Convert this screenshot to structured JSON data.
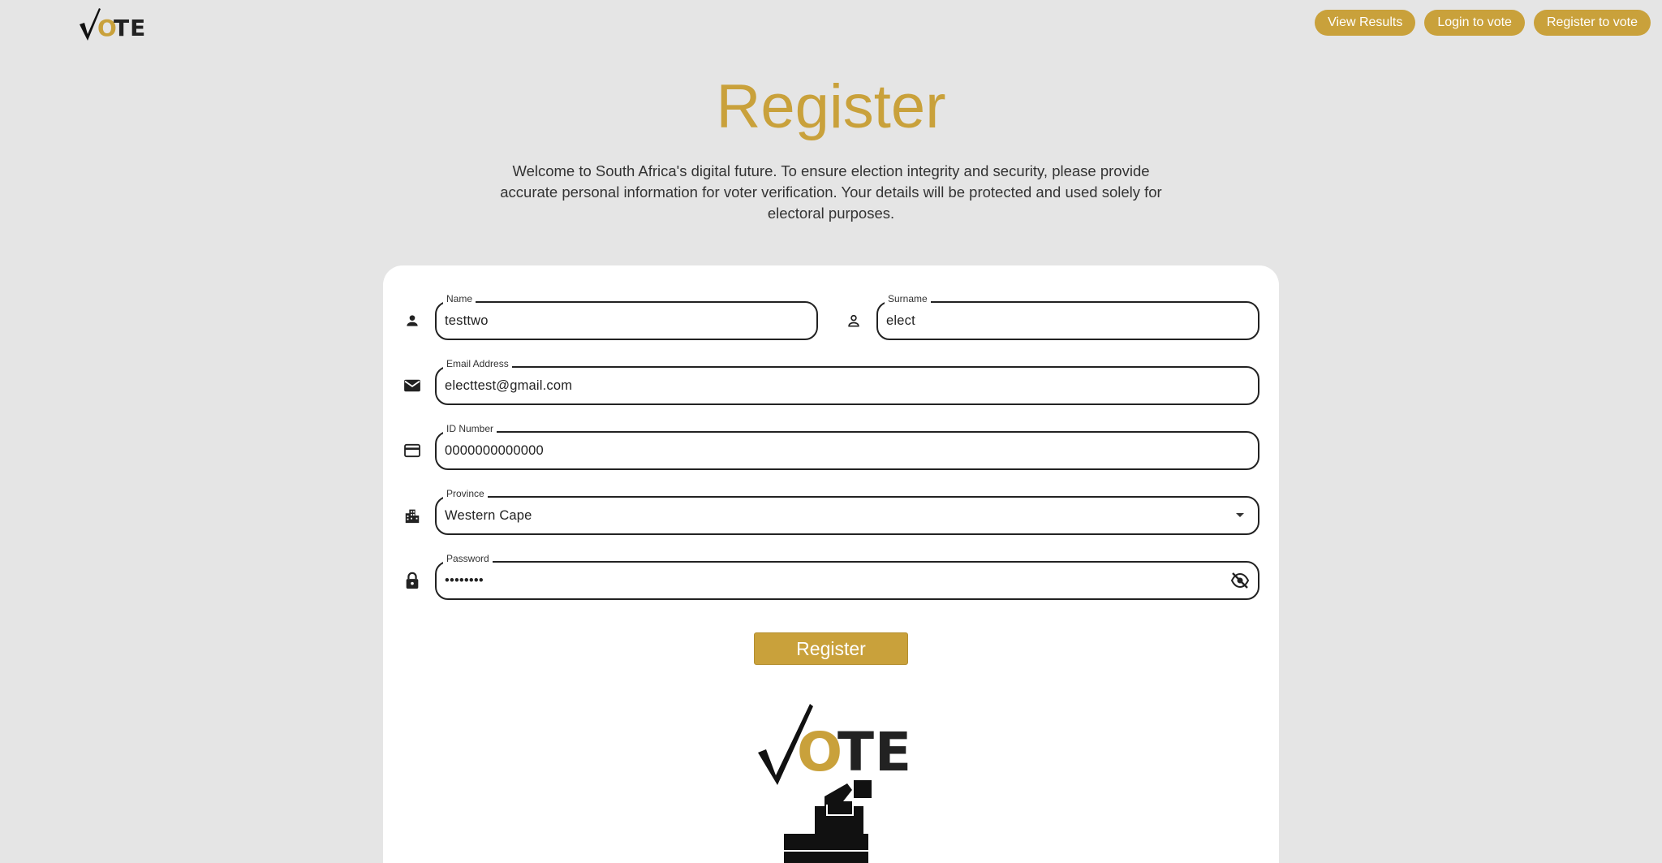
{
  "header": {
    "logo": {
      "check": "√",
      "o": "O",
      "te": "TE"
    },
    "nav": [
      {
        "label": "View Results"
      },
      {
        "label": "Login to vote"
      },
      {
        "label": "Register to vote"
      }
    ]
  },
  "page": {
    "title": "Register",
    "intro": "Welcome to South Africa's digital future. To ensure election integrity and security, please provide accurate personal information for voter verification. Your details will be protected and used solely for electoral purposes."
  },
  "form": {
    "name": {
      "label": "Name",
      "value": "testtwo",
      "icon": "person-icon"
    },
    "surname": {
      "label": "Surname",
      "value": "elect",
      "icon": "person-outline-icon"
    },
    "email": {
      "label": "Email Address",
      "value": "electtest@gmail.com",
      "icon": "mail-icon"
    },
    "id_number": {
      "label": "ID Number",
      "value": "0000000000000",
      "icon": "credit-card-icon"
    },
    "province": {
      "label": "Province",
      "value": "Western Cape",
      "icon": "city-icon"
    },
    "password": {
      "label": "Password",
      "value": "••••••••",
      "icon": "lock-icon"
    },
    "submit_label": "Register"
  },
  "colors": {
    "accent": "#c9a13b",
    "background": "#e5e5e5",
    "card": "#ffffff",
    "logo_dark": "#222222"
  }
}
